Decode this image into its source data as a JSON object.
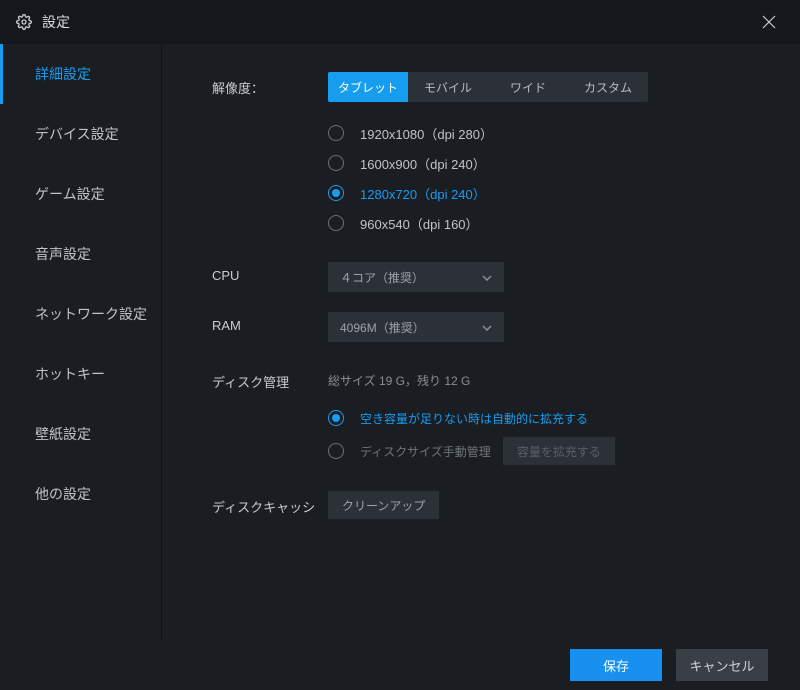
{
  "window": {
    "title": "設定"
  },
  "sidebar": {
    "items": [
      {
        "label": "詳細設定",
        "active": true
      },
      {
        "label": "デバイス設定",
        "active": false
      },
      {
        "label": "ゲーム設定",
        "active": false
      },
      {
        "label": "音声設定",
        "active": false
      },
      {
        "label": "ネットワーク設定",
        "active": false
      },
      {
        "label": "ホットキー",
        "active": false
      },
      {
        "label": "壁紙設定",
        "active": false
      },
      {
        "label": "他の設定",
        "active": false
      }
    ]
  },
  "resolution": {
    "label": "解像度：",
    "tabs": [
      {
        "label": "タブレット",
        "active": true
      },
      {
        "label": "モバイル",
        "active": false
      },
      {
        "label": "ワイド",
        "active": false
      },
      {
        "label": "カスタム",
        "active": false
      }
    ],
    "options": [
      {
        "label": "1920x1080（dpi 280）",
        "checked": false
      },
      {
        "label": "1600x900（dpi 240）",
        "checked": false
      },
      {
        "label": "1280x720（dpi 240）",
        "checked": true
      },
      {
        "label": "960x540（dpi 160）",
        "checked": false
      }
    ]
  },
  "cpu": {
    "label": "CPU",
    "value": "４コア（推奨）"
  },
  "ram": {
    "label": "RAM",
    "value": "4096M（推奨）"
  },
  "disk": {
    "label": "ディスク管理",
    "summary": "総サイズ 19 G，残り 12 G",
    "options": [
      {
        "label": "空き容量が足りない時は自動的に拡充する",
        "checked": true
      },
      {
        "label": "ディスクサイズ手動管理",
        "checked": false
      }
    ],
    "expand_button": "容量を拡充する"
  },
  "cache": {
    "label": "ディスクキャッシ",
    "button": "クリーンアップ"
  },
  "footer": {
    "save": "保存",
    "cancel": "キャンセル"
  }
}
